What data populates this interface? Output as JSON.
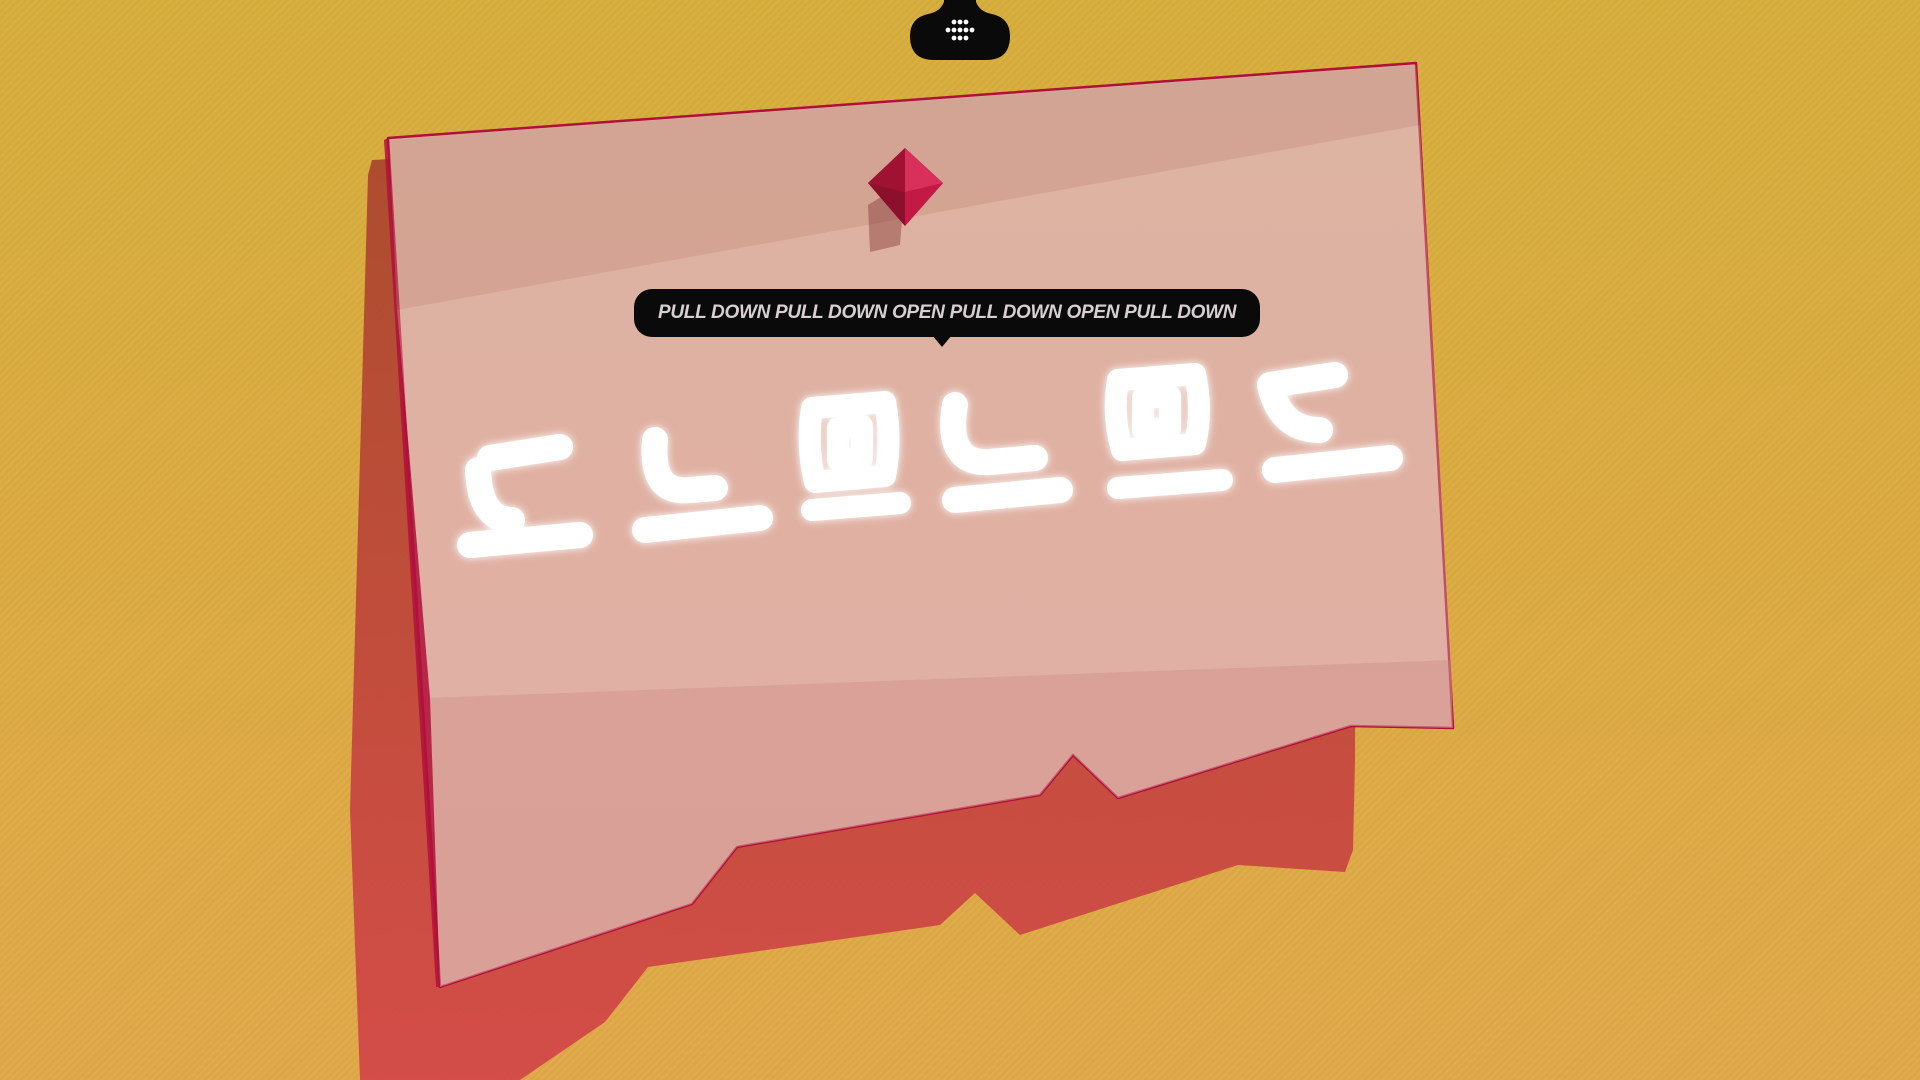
{
  "colors": {
    "background_top": "#d7ae3b",
    "background_bottom": "#e0a948",
    "panel": "#d8aa98",
    "panel_edge": "#b0103a",
    "gem": "#b5163a",
    "tooltip_bg": "#0a0a0a",
    "tooltip_text": "#d8d0d0"
  },
  "menu_handle": {
    "icon": "menu-grid-icon"
  },
  "tooltip": {
    "text": "PULL DOWN PULL DOWN OPEN PULL DOWN OPEN PULL DOWN"
  },
  "puzzle": {
    "glyphs": [
      "pull-down",
      "pull-down",
      "open",
      "pull-down",
      "open",
      "pull-down"
    ],
    "pin_icon": "gem-pin-icon"
  }
}
